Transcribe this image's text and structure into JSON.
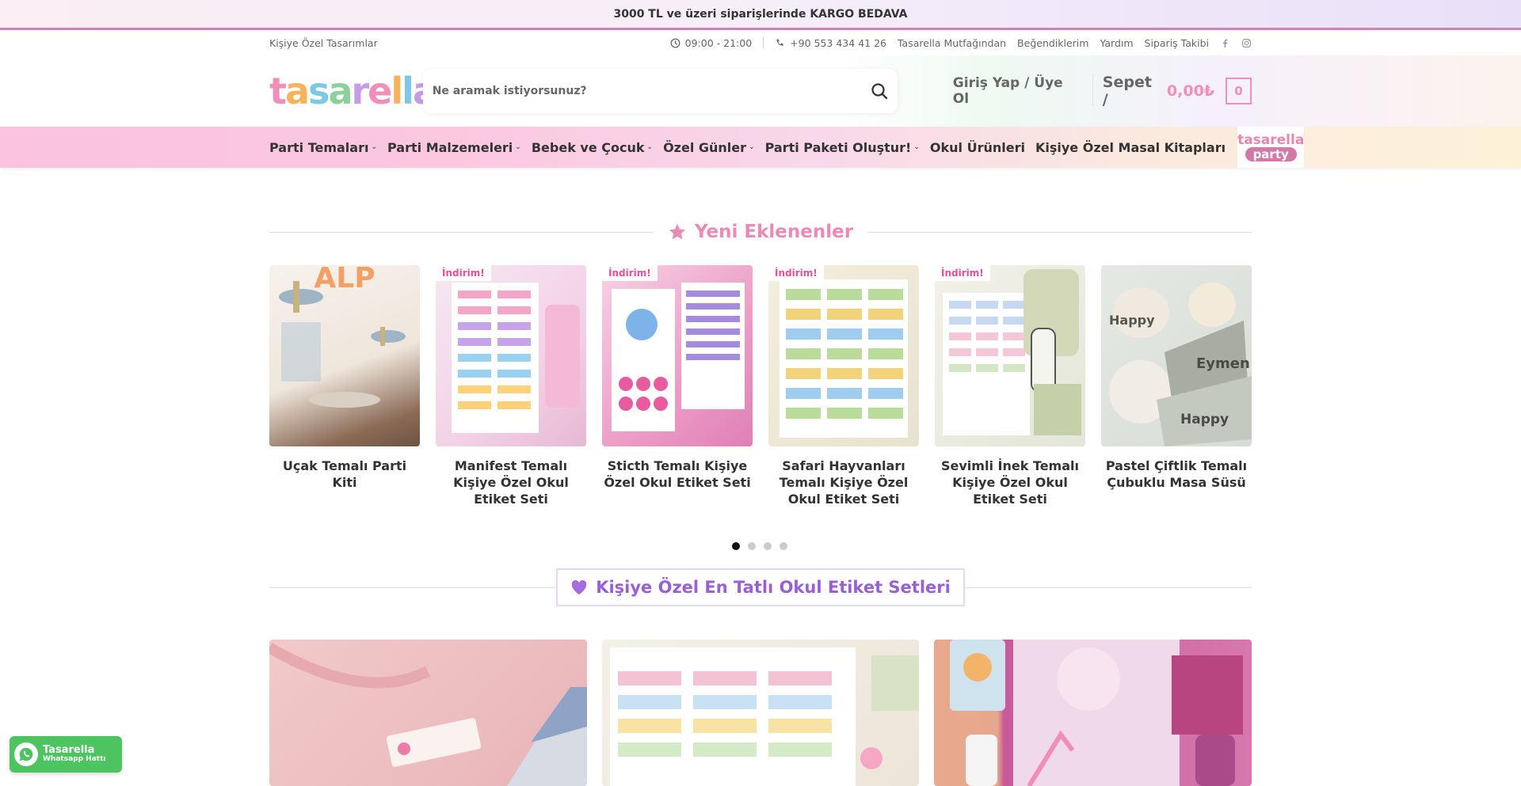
{
  "topbar": {
    "text": "3000 TL ve üzeri siparişlerinde KARGO BEDAVA"
  },
  "utilbar": {
    "left": "Kişiye Özel Tasarımlar",
    "hours": "09:00 - 21:00",
    "phone": "+90 553 434 41 26",
    "links": [
      "Tasarella Mutfağından",
      "Beğendiklerim",
      "Yardım",
      "Sipariş Takibi"
    ]
  },
  "header": {
    "logo": "tasarella",
    "search_placeholder": "Ne aramak istiyorsunuz?",
    "login": "Giriş Yap / Üye Ol",
    "cart_label": "Sepet /",
    "cart_price": "0,00₺",
    "cart_count": "0"
  },
  "nav": {
    "items": [
      {
        "label": "Parti Temaları",
        "dropdown": true
      },
      {
        "label": "Parti Malzemeleri",
        "dropdown": true
      },
      {
        "label": "Bebek ve Çocuk",
        "dropdown": true
      },
      {
        "label": "Özel Günler",
        "dropdown": true
      },
      {
        "label": "Parti Paketi Oluştur!",
        "dropdown": true
      },
      {
        "label": "Okul Ürünleri",
        "dropdown": false
      },
      {
        "label": "Kişiye Özel Masal Kitapları",
        "dropdown": false
      }
    ],
    "party_badge": {
      "line1": "tasarella",
      "line2": "party"
    }
  },
  "new_section": {
    "title": "Yeni Eklenenler",
    "products": [
      {
        "name": "Uçak Temalı Parti Kiti",
        "badge": ""
      },
      {
        "name": "Manifest Temalı Kişiye Özel Okul Etiket Seti",
        "badge": "İndirim!"
      },
      {
        "name": "Sticth Temalı Kişiye Özel Okul Etiket Seti",
        "badge": "İndirim!"
      },
      {
        "name": "Safari Hayvanları Temalı Kişiye Özel Okul Etiket Seti",
        "badge": "İndirim!"
      },
      {
        "name": "Sevimli İnek Temalı Kişiye Özel Okul Etiket Seti",
        "badge": "İndirim!"
      },
      {
        "name": "Pastel Çiftlik Temalı Çubuklu Masa Süsü",
        "badge": ""
      }
    ],
    "pagination": {
      "pages": 4,
      "active": 1
    }
  },
  "labels_section": {
    "title": "Kişiye Özel En Tatlı Okul Etiket Setleri"
  },
  "whatsapp": {
    "line1": "Tasarella",
    "line2": "Whatsapp Hattı"
  },
  "colors": {
    "accent_pink": "#ec8ab6",
    "accent_purple": "#9a5fd4",
    "whatsapp_green": "#4dc45f"
  }
}
